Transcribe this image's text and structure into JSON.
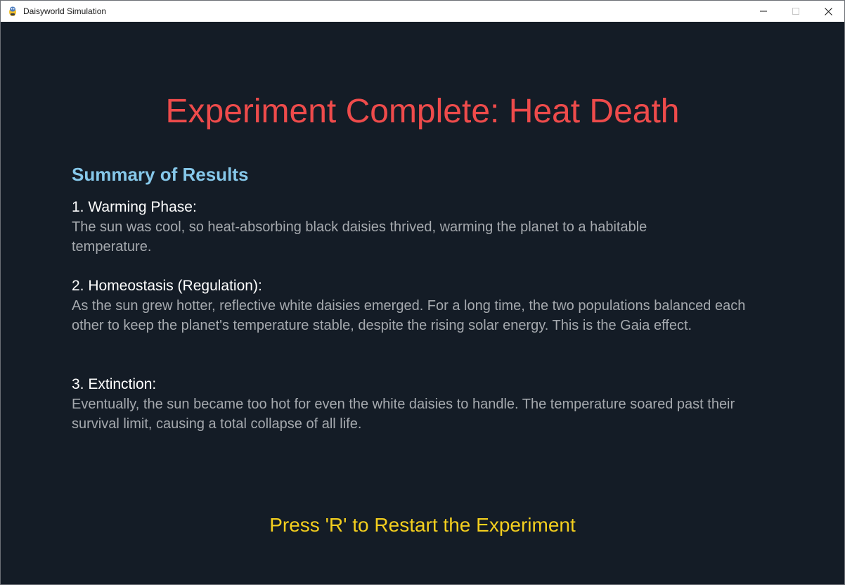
{
  "window": {
    "title": "Daisyworld Simulation",
    "icon": "pygame-snake-icon"
  },
  "screen": {
    "heading": "Experiment Complete: Heat Death",
    "summary_title": "Summary of Results",
    "phases": [
      {
        "title": "1. Warming Phase:",
        "text": "The sun was cool, so heat-absorbing black daisies thrived, warming the planet to a habitable temperature."
      },
      {
        "title": "2. Homeostasis (Regulation):",
        "text": "As the sun grew hotter, reflective white daisies emerged. For a long time, the two populations balanced each other to keep the planet's temperature stable, despite the rising solar energy. This is the Gaia effect."
      },
      {
        "title": "3. Extinction:",
        "text": "Eventually, the sun became too hot for even the white daisies to handle. The temperature soared past their survival limit, causing a total collapse of all life."
      }
    ],
    "restart_prompt": "Press 'R' to Restart the Experiment"
  },
  "colors": {
    "background": "#141c26",
    "heading": "#ee4b4b",
    "summary_title": "#86c8ea",
    "phase_title": "#ffffff",
    "phase_text": "#a5a9ae",
    "restart_prompt": "#f4cf1e"
  }
}
